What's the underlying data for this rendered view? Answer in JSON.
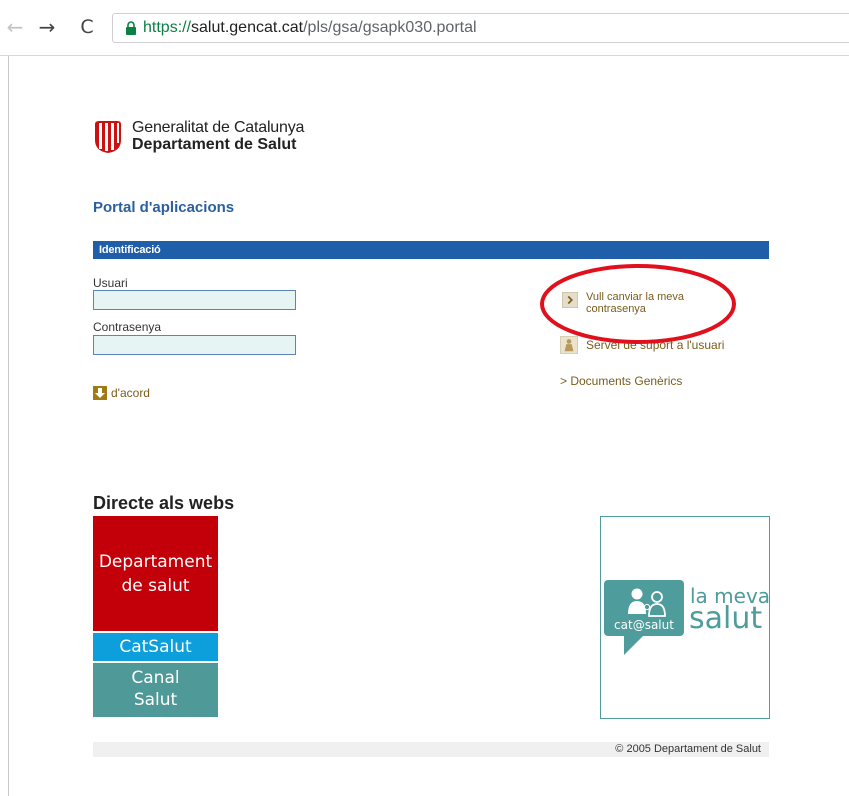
{
  "browser": {
    "back_glyph": "←",
    "forward_glyph": "→",
    "reload_glyph": "C",
    "url_scheme": "https://",
    "url_host": "salut.gencat.cat",
    "url_path": "/pls/gsa/gsapk030.portal"
  },
  "header": {
    "logo_line1": "Generalitat de Catalunya",
    "logo_line2": "Departament de Salut",
    "logo_color": "#cc1111"
  },
  "portal": {
    "title": "Portal d'aplicacions",
    "section_label": "Identificació"
  },
  "login": {
    "user_label": "Usuari",
    "user_value": "",
    "password_label": "Contrasenya",
    "password_value": "",
    "submit_label": "d'acord"
  },
  "links": {
    "change_password": "Vull canviar la meva contrasenya",
    "support": "Servei de suport a l'usuari",
    "documents": "> Documents Genèrics"
  },
  "webs": {
    "title": "Directe als webs",
    "tiles": [
      {
        "label_line1": "Departament",
        "label_line2": "de salut",
        "color": "#c3000a"
      },
      {
        "label": "CatSalut",
        "color": "#0c9fdc"
      },
      {
        "label_line1": "Canal",
        "label_line2": "Salut",
        "color": "#4f9a98"
      }
    ]
  },
  "promo": {
    "bubble_label": "cat@salut",
    "line1": "la meva",
    "line2": "salut",
    "color": "#4e9c9c"
  },
  "footer": {
    "copyright": "© 2005 Departament de Salut"
  },
  "colors": {
    "section_bar": "#1f5ea8",
    "portal_title": "#2b5f9e",
    "link_text": "#7a5c1c",
    "annotation_ellipse": "#e0101c"
  }
}
